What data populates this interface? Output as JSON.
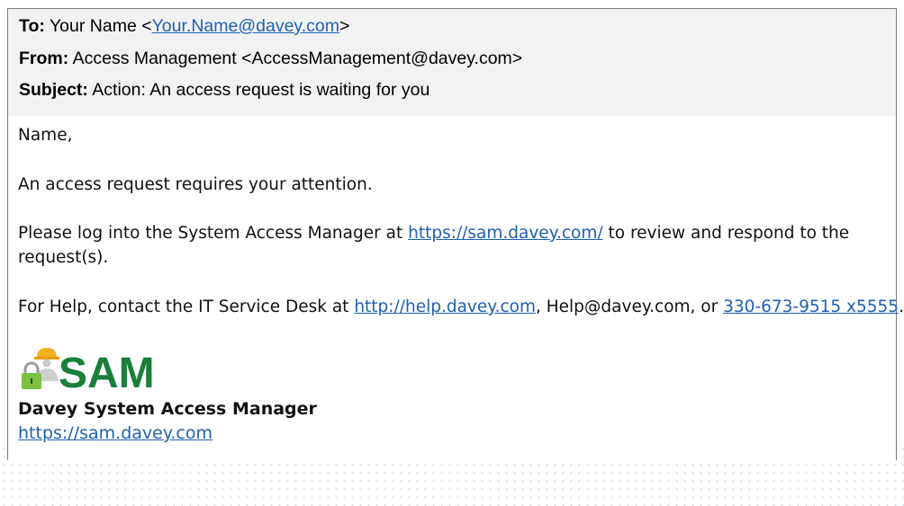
{
  "email": {
    "to": {
      "label": "To:",
      "name": "Your Name <",
      "address": "Your.Name@davey.com",
      "close": ">"
    },
    "from": {
      "label": "From:",
      "value": "Access Management <AccessManagement@davey.com>"
    },
    "subject": {
      "label": "Subject:",
      "value": "Action: An access request is waiting for you"
    },
    "body": {
      "greeting": "Name,",
      "line1": "An access request requires your attention.",
      "line2_pre": "Please log into the System Access Manager at ",
      "line2_link": "https://sam.davey.com/",
      "line2_post": " to review and respond to the",
      "line2_cont": "request(s).",
      "line3_pre": "For Help, contact the IT Service Desk at ",
      "line3_link": "http://help.davey.com",
      "line3_mid": ", Help@davey.com, or ",
      "line3_phone": "330-673-9515 x5555",
      "line3_end": "."
    },
    "signature": {
      "logo_text": "SAM",
      "title": "Davey System Access Manager",
      "url": "https://sam.davey.com"
    }
  },
  "colors": {
    "link": "#1f5fb2",
    "logo_green": "#1a7f3a",
    "header_bg": "#f2f2f2",
    "hardhat": "#f2b01e"
  }
}
